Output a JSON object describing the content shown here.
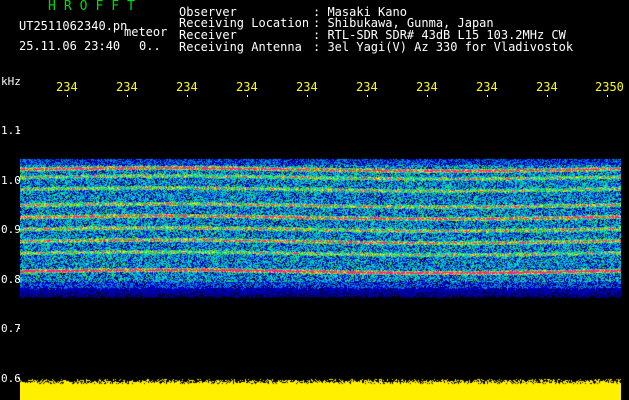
{
  "header": {
    "brand": "HROFFT",
    "filename": "UT2511062340.pn",
    "meteor_label": "meteor",
    "datetime": "25.11.06 23:40",
    "count": "0..",
    "fields": [
      {
        "label": "Observer",
        "value": ": Masaki Kano"
      },
      {
        "label": "Receiving Location",
        "value": ": Shibukawa, Gunma, Japan"
      },
      {
        "label": "Receiver",
        "value": ": RTL-SDR SDR# 43dB L15 103.2MHz CW"
      },
      {
        "label": "Receiving Antenna",
        "value": ": 3el Yagi(V) Az 330 for Vladivostok"
      }
    ]
  },
  "yaxis": {
    "unit": "kHz",
    "ticks": [
      "1.1",
      "1.0",
      "0.9",
      "0.8",
      "0.7",
      "0.6"
    ]
  },
  "xaxis": {
    "ticks": [
      "234",
      "234",
      "234",
      "234",
      "234",
      "234",
      "234",
      "234",
      "234",
      "2350"
    ]
  },
  "colors": {
    "background": "#000000",
    "header_text": "#ffffff",
    "brand": "#00dd00",
    "tick_labels": "#ffff00"
  }
}
